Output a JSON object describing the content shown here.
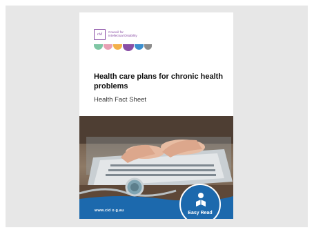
{
  "logo": {
    "mark": "cid",
    "org_line1": "Council for",
    "org_line2": "Intellectual Disability"
  },
  "dot_colors": [
    "#7fc6a4",
    "#e8a0b4",
    "#f3b04a",
    "#8a4fa6",
    "#3c8fcf",
    "#8c8c8c"
  ],
  "title": "Health care plans for chronic health problems",
  "subtitle": "Health Fact Sheet",
  "footer": {
    "url": "www.cid o g.au",
    "band_color": "#1c69ad"
  },
  "badge": {
    "label": "Easy Read",
    "icon": "reader-icon"
  }
}
